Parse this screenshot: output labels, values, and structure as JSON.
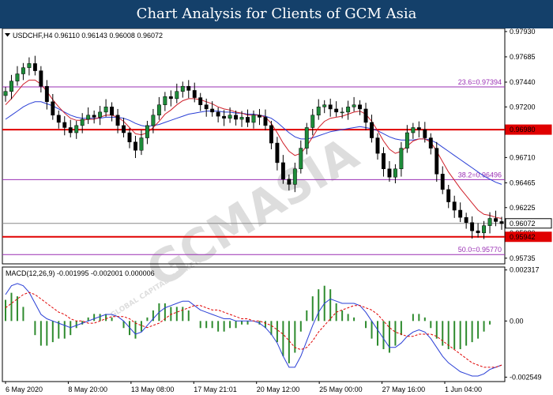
{
  "title": "Chart Analysis for Clients of GCM Asia",
  "watermark": {
    "main": "GCMASIA",
    "small": "GLOBAL CAPITAL MARKETS"
  },
  "colors": {
    "title_bg": "#14406a",
    "bull_candle": "#1e8c3a",
    "bear_candle": "#000000",
    "ma_fast": "#d0202a",
    "ma_slow": "#2a3fd6",
    "fib": "#9a2fb4",
    "sr_line": "#e00000",
    "current_price": "#888888",
    "macd_line": "#2a3fd6",
    "signal_line": "#e00000",
    "macd_hist": "#2e8b2e"
  },
  "chart_data": [
    {
      "type": "candlestick",
      "symbol_header": "USDCHF,H4  0.96110 0.96143 0.96008 0.96072",
      "ylim": [
        0.9568,
        0.9796
      ],
      "y_ticks": [
        "0.97930",
        "0.97685",
        "0.97440",
        "0.97200",
        "0.96955",
        "0.96710",
        "0.96465",
        "0.96225",
        "0.95980",
        "0.95735"
      ],
      "x_ticks": [
        "6 May 2020",
        "8 May 20:00",
        "13 May 08:00",
        "17 May 21:01",
        "20 May 12:00",
        "25 May 00:00",
        "27 May 16:00",
        "1 Jun 04:00"
      ],
      "levels": [
        {
          "label": "23.6=0.97394",
          "price": 0.97394,
          "kind": "fibonacci"
        },
        {
          "label": "38.2=0.96496",
          "price": 0.96496,
          "kind": "fibonacci"
        },
        {
          "label": "50.0=0.95770",
          "price": 0.9577,
          "kind": "fibonacci"
        },
        {
          "label": "0.96980",
          "price": 0.9698,
          "kind": "resistance"
        },
        {
          "label": "0.95942",
          "price": 0.95942,
          "kind": "support"
        },
        {
          "label": "0.96072",
          "price": 0.96072,
          "kind": "current"
        }
      ],
      "close_series": [
        0.9735,
        0.9745,
        0.9752,
        0.9758,
        0.9762,
        0.9755,
        0.974,
        0.9725,
        0.9712,
        0.9705,
        0.97,
        0.9695,
        0.9702,
        0.9708,
        0.9712,
        0.971,
        0.9715,
        0.972,
        0.9712,
        0.9702,
        0.9695,
        0.9686,
        0.9678,
        0.969,
        0.9702,
        0.9712,
        0.9722,
        0.973,
        0.9728,
        0.9735,
        0.974,
        0.9736,
        0.9729,
        0.9722,
        0.9718,
        0.9715,
        0.9711,
        0.9709,
        0.9712,
        0.9708,
        0.971,
        0.9705,
        0.9712,
        0.971,
        0.9702,
        0.9685,
        0.9666,
        0.965,
        0.9645,
        0.966,
        0.968,
        0.97,
        0.9712,
        0.972,
        0.9722,
        0.9718,
        0.9715,
        0.9715,
        0.972,
        0.9722,
        0.9718,
        0.9705,
        0.969,
        0.9675,
        0.966,
        0.9652,
        0.966,
        0.968,
        0.9695,
        0.97,
        0.9698,
        0.969,
        0.968,
        0.9655,
        0.964,
        0.9628,
        0.962,
        0.9613,
        0.9608,
        0.96,
        0.9598,
        0.9605,
        0.9612,
        0.9609,
        0.9607
      ],
      "ma_fast": [
        0.9722,
        0.9728,
        0.9735,
        0.9742,
        0.9746,
        0.9746,
        0.9742,
        0.9735,
        0.9727,
        0.972,
        0.9714,
        0.9709,
        0.9707,
        0.9707,
        0.9708,
        0.9708,
        0.971,
        0.9712,
        0.9712,
        0.971,
        0.9706,
        0.97,
        0.9694,
        0.9693,
        0.9695,
        0.97,
        0.9706,
        0.9713,
        0.9717,
        0.9722,
        0.9726,
        0.9728,
        0.9728,
        0.9727,
        0.9725,
        0.9723,
        0.972,
        0.9718,
        0.9717,
        0.9715,
        0.9714,
        0.9712,
        0.9712,
        0.9712,
        0.971,
        0.9704,
        0.9695,
        0.9685,
        0.9677,
        0.9673,
        0.9675,
        0.9682,
        0.9691,
        0.97,
        0.9706,
        0.9709,
        0.971,
        0.9711,
        0.9713,
        0.9715,
        0.9716,
        0.9713,
        0.9706,
        0.9697,
        0.9687,
        0.9679,
        0.9675,
        0.9677,
        0.9682,
        0.9687,
        0.9689,
        0.9689,
        0.9686,
        0.9677,
        0.9667,
        0.9657,
        0.9649,
        0.9641,
        0.9634,
        0.9627,
        0.962,
        0.9616,
        0.9615,
        0.9613,
        0.9612
      ],
      "ma_slow": [
        0.9708,
        0.9712,
        0.9716,
        0.972,
        0.9723,
        0.9725,
        0.9725,
        0.9723,
        0.9721,
        0.9718,
        0.9715,
        0.9712,
        0.971,
        0.9709,
        0.9709,
        0.9709,
        0.9709,
        0.971,
        0.971,
        0.971,
        0.9709,
        0.9707,
        0.9704,
        0.9702,
        0.9701,
        0.9702,
        0.9703,
        0.9705,
        0.9707,
        0.9709,
        0.9711,
        0.9713,
        0.9714,
        0.9715,
        0.9716,
        0.9716,
        0.9716,
        0.9715,
        0.9715,
        0.9714,
        0.9714,
        0.9713,
        0.9713,
        0.9712,
        0.9711,
        0.9709,
        0.9705,
        0.97,
        0.9695,
        0.9691,
        0.9689,
        0.9689,
        0.969,
        0.9692,
        0.9694,
        0.9696,
        0.9697,
        0.9698,
        0.9699,
        0.97,
        0.9701,
        0.97,
        0.9699,
        0.9697,
        0.9694,
        0.9691,
        0.9689,
        0.9688,
        0.9688,
        0.9688,
        0.9689,
        0.9689,
        0.9688,
        0.9685,
        0.9681,
        0.9677,
        0.9673,
        0.9669,
        0.9665,
        0.9661,
        0.9657,
        0.9653,
        0.965,
        0.9647,
        0.9645
      ]
    },
    {
      "type": "macd",
      "header": "MACD(12,26,9) -0.001995 -0.002001 0.000006",
      "ylim": [
        -0.00275,
        0.00245
      ],
      "y_ticks": [
        "0.002317",
        "0.00",
        "-0.002549"
      ],
      "macd": [
        0.0012,
        0.0016,
        0.0017,
        0.0016,
        0.0013,
        0.0008,
        0.0003,
        0.0001,
        0.0,
        -0.0001,
        -0.0002,
        -0.0003,
        -0.0002,
        -0.0001,
        0.0,
        0.0001,
        0.0002,
        0.0003,
        0.0003,
        0.0002,
        0.0,
        -0.0003,
        -0.0006,
        -0.0005,
        -0.0002,
        0.0001,
        0.0004,
        0.0006,
        0.0007,
        0.0008,
        0.0009,
        0.0009,
        0.0007,
        0.0005,
        0.0004,
        0.0003,
        0.0002,
        0.0001,
        0.0001,
        0.0,
        0.0,
        0.0,
        0.0,
        -0.0001,
        -0.0003,
        -0.0006,
        -0.001,
        -0.0016,
        -0.0021,
        -0.0021,
        -0.0016,
        -0.0009,
        -0.0002,
        0.0004,
        0.0008,
        0.001,
        0.0009,
        0.0008,
        0.0008,
        0.0008,
        0.0007,
        0.0004,
        0.0,
        -0.0004,
        -0.0008,
        -0.0012,
        -0.0012,
        -0.001,
        -0.0007,
        -0.0005,
        -0.0004,
        -0.0005,
        -0.0008,
        -0.0012,
        -0.0016,
        -0.0019,
        -0.0021,
        -0.0023,
        -0.0024,
        -0.0025,
        -0.0025,
        -0.0024,
        -0.0022,
        -0.0021,
        -0.002
      ],
      "signal": [
        0.0006,
        0.0008,
        0.001,
        0.0012,
        0.0013,
        0.0012,
        0.001,
        0.0008,
        0.0006,
        0.0004,
        0.0003,
        0.0001,
        0.0,
        0.0,
        -0.0001,
        -0.0001,
        0.0,
        0.0001,
        0.0002,
        0.0002,
        0.0002,
        0.0001,
        -0.0001,
        -0.0002,
        -0.0003,
        -0.0002,
        -0.0001,
        0.0001,
        0.0003,
        0.0004,
        0.0005,
        0.0006,
        0.0007,
        0.0007,
        0.0006,
        0.0005,
        0.0005,
        0.0004,
        0.0003,
        0.0002,
        0.0001,
        0.0001,
        0.0,
        0.0,
        -0.0001,
        -0.0002,
        -0.0004,
        -0.0006,
        -0.0009,
        -0.0012,
        -0.0013,
        -0.0012,
        -0.0009,
        -0.0005,
        -0.0002,
        0.0001,
        0.0004,
        0.0005,
        0.0006,
        0.0007,
        0.0007,
        0.0006,
        0.0005,
        0.0003,
        0.0,
        -0.0003,
        -0.0005,
        -0.0006,
        -0.0007,
        -0.0007,
        -0.0006,
        -0.0006,
        -0.0006,
        -0.0007,
        -0.0009,
        -0.0011,
        -0.0013,
        -0.0015,
        -0.0017,
        -0.0019,
        -0.002,
        -0.0021,
        -0.0021,
        -0.0021,
        -0.002
      ]
    }
  ]
}
